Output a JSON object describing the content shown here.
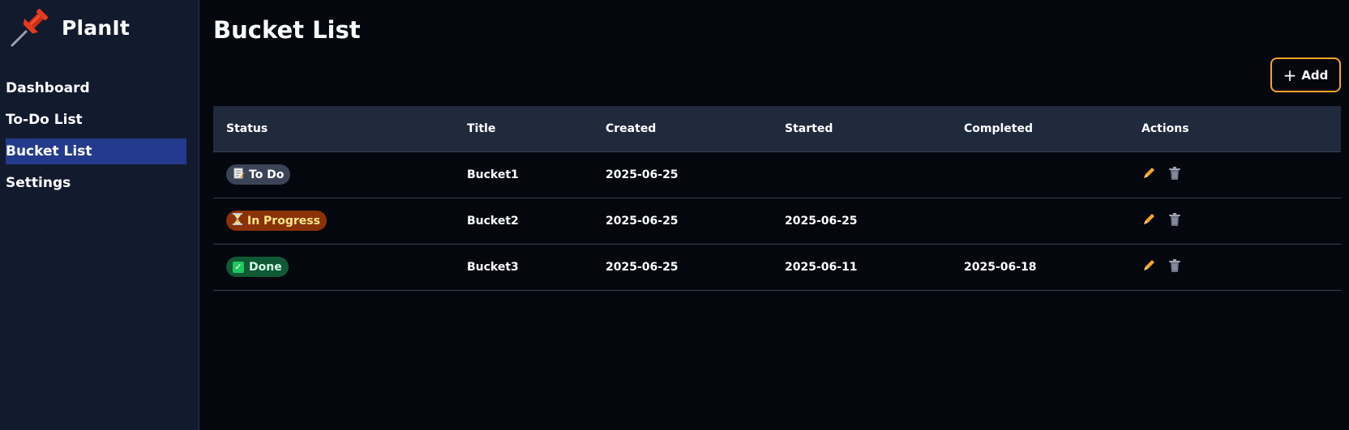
{
  "brand": {
    "name": "PlanIt",
    "logo_icon": "pushpin-icon"
  },
  "sidebar": {
    "items": [
      {
        "label": "Dashboard",
        "active": false
      },
      {
        "label": "To-Do List",
        "active": false
      },
      {
        "label": "Bucket List",
        "active": true
      },
      {
        "label": "Settings",
        "active": false
      }
    ]
  },
  "page": {
    "title": "Bucket List"
  },
  "toolbar": {
    "add_label": "Add",
    "add_icon": "plus-icon"
  },
  "table": {
    "headers": {
      "status": "Status",
      "title": "Title",
      "created": "Created",
      "started": "Started",
      "completed": "Completed",
      "actions": "Actions"
    },
    "rows": [
      {
        "status": "To Do",
        "status_icon": "memo-icon",
        "title": "Bucket1",
        "created": "2025-06-25",
        "started": "",
        "completed": ""
      },
      {
        "status": "In Progress",
        "status_icon": "hourglass-icon",
        "title": "Bucket2",
        "created": "2025-06-25",
        "started": "2025-06-25",
        "completed": ""
      },
      {
        "status": "Done",
        "status_icon": "check-mark-icon",
        "title": "Bucket3",
        "created": "2025-06-25",
        "started": "2025-06-11",
        "completed": "2025-06-18"
      }
    ]
  },
  "colors": {
    "background": "#05070f",
    "sidebar": "#121a2e",
    "active_nav": "#243a8c",
    "accent": "#f5a524",
    "header_row": "#1f2a3c"
  }
}
